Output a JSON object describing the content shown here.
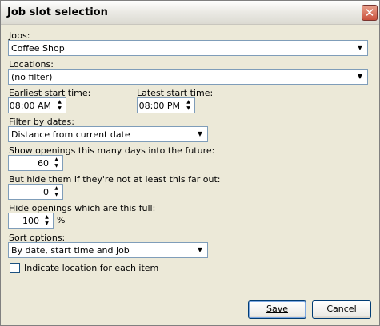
{
  "dialog": {
    "title": "Job slot selection"
  },
  "jobs": {
    "label": "Jobs:",
    "value": "Coffee Shop"
  },
  "locations": {
    "label": "Locations:",
    "value": "(no filter)"
  },
  "earliest": {
    "label": "Earliest start time:",
    "value": "08:00 AM"
  },
  "latest": {
    "label": "Latest start time:",
    "value": "08:00 PM"
  },
  "filter_dates": {
    "label": "Filter by dates:",
    "value": "Distance from current date"
  },
  "days_future": {
    "label": "Show openings this many days into the future:",
    "value": "60"
  },
  "hide_far": {
    "label": "But hide them if they're not at least this far out:",
    "value": "0"
  },
  "hide_full": {
    "label": "Hide openings which are this full:",
    "value": "100",
    "unit": "%"
  },
  "sort": {
    "label": "Sort options:",
    "value": "By date, start time and job"
  },
  "indicate": {
    "label": "Indicate location for each item",
    "checked": false
  },
  "buttons": {
    "save": "Save",
    "cancel": "Cancel"
  },
  "icons": {
    "close": "close-icon",
    "dropdown": "chevron-down-icon",
    "spin_up": "arrow-up-icon",
    "spin_down": "arrow-down-icon"
  }
}
